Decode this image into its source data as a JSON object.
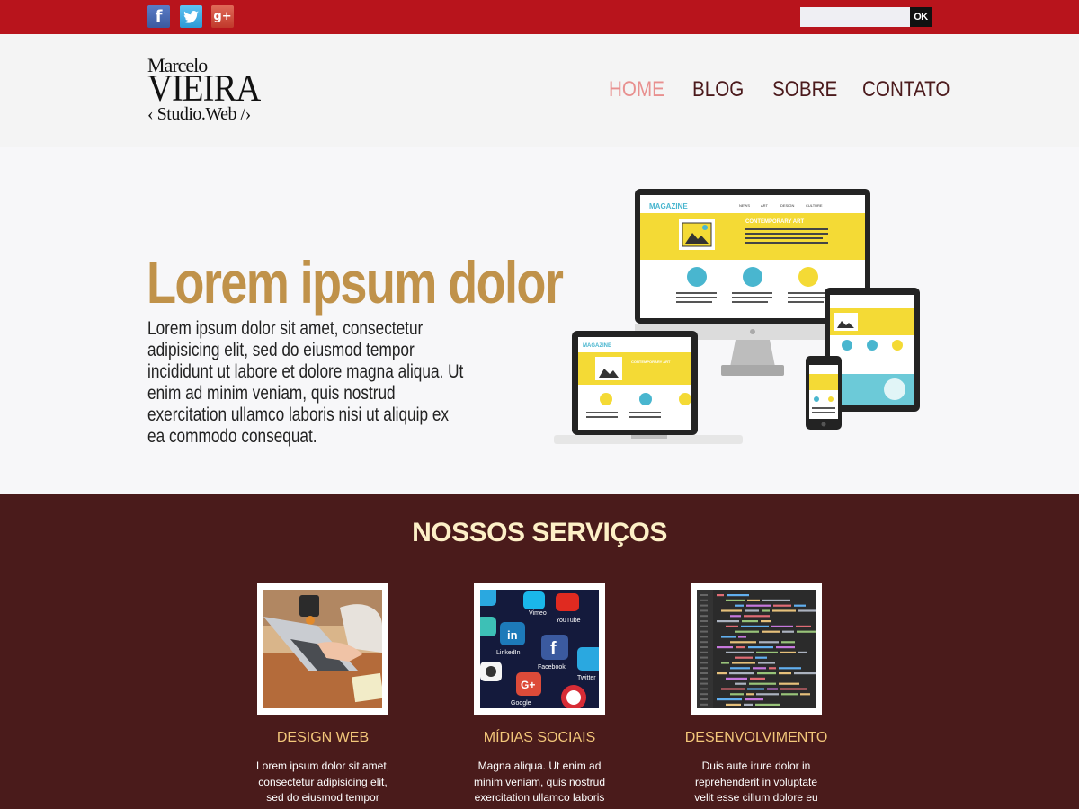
{
  "topbar": {
    "social": [
      {
        "name": "facebook-icon",
        "glyph": "f"
      },
      {
        "name": "twitter-icon",
        "glyph": "t"
      },
      {
        "name": "google-plus-icon",
        "glyph": "g+"
      }
    ],
    "search": {
      "value": "",
      "button_label": "OK"
    },
    "colors": {
      "bar": "#b8141c"
    }
  },
  "logo": {
    "line1": "Marcelo",
    "line2": "VIEIRA",
    "line3": "‹ Studio.Web /›"
  },
  "nav": {
    "home": "HOME",
    "blog": "BLOG",
    "sobre": "SOBRE",
    "contato": "CONTATO",
    "active": "HOME"
  },
  "hero": {
    "title": "Lorem ipsum dolor",
    "text": "Lorem ipsum dolor sit amet, consectetur adipisicing elit, sed do eiusmod tempor incididunt ut labore et dolore magna aliqua. Ut enim ad minim veniam, quis nostrud exercitation ullamco laboris nisi ut aliquip ex ea commodo consequat.",
    "illustration": {
      "magazine_label": "MAGAZINE",
      "menu": [
        "NEWS",
        "ART",
        "DESIGN",
        "CULTURE"
      ],
      "banner": "CONTEMPORARY ART"
    }
  },
  "services": {
    "title": "NOSSOS SERVIÇOS",
    "items": [
      {
        "title": "DESIGN WEB",
        "text": "Lorem ipsum dolor sit amet, consectetur adipisicing elit, sed do eiusmod tempor"
      },
      {
        "title": "MÍDIAS SOCIAIS",
        "text": "Magna aliqua. Ut enim ad minim veniam, quis nostrud exercitation ullamco laboris"
      },
      {
        "title": "DESENVOLVIMENTO",
        "text": "Duis aute irure dolor in reprehenderit in voluptate velit esse cillum dolore eu"
      }
    ],
    "app_labels": [
      "Vimeo",
      "YouTube",
      "LinkedIn",
      "Facebook",
      "Twitter",
      "Google"
    ]
  },
  "colors": {
    "accent": "#c0924a",
    "services_bg": "#4a1b1b",
    "nav_active": "#e8908f",
    "nav": "#4b1a1c",
    "services_title": "#fdf0c7",
    "service_heading": "#f3c77a"
  }
}
